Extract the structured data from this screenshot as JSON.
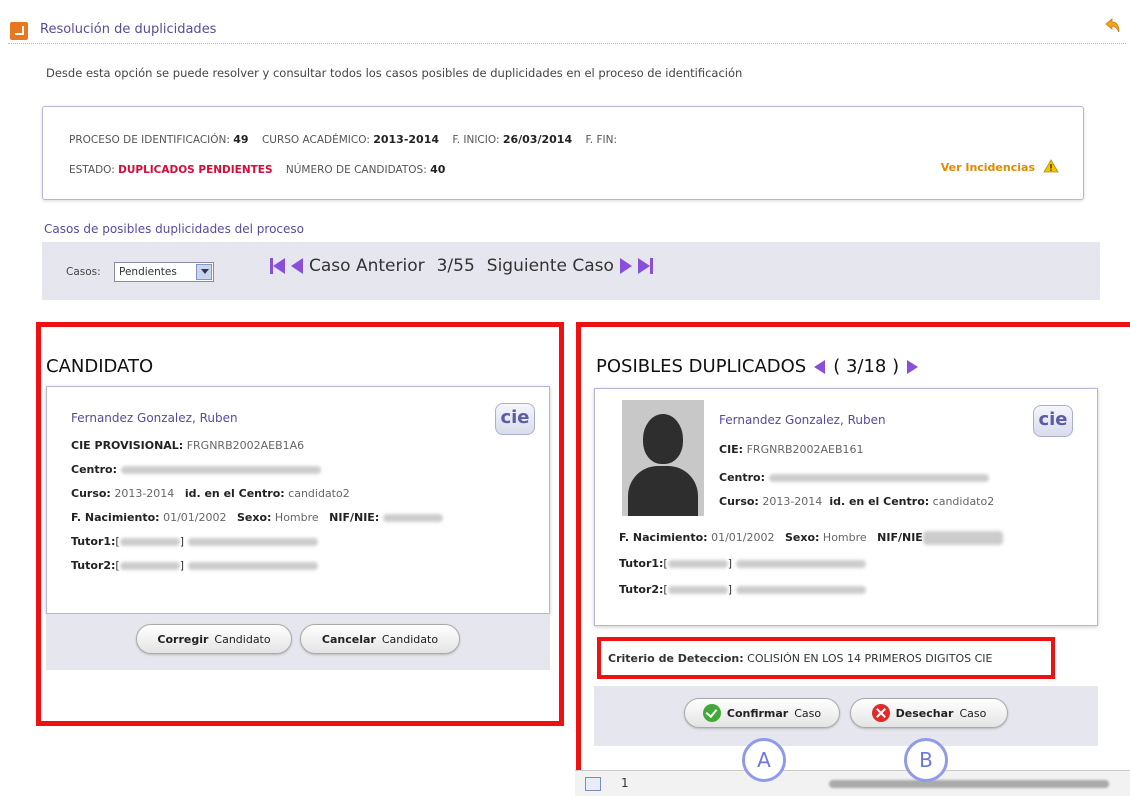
{
  "header": {
    "title": "Resolución de duplicidades",
    "description": "Desde esta opción se puede resolver y consultar todos los casos posibles de duplicidades en el proceso de identificación"
  },
  "info": {
    "proceso_label": "PROCESO DE IDENTIFICACIÓN:",
    "proceso_value": "49",
    "curso_label": "CURSO ACADÉMICO:",
    "curso_value": "2013-2014",
    "inicio_label": "F. INICIO:",
    "inicio_value": "26/03/2014",
    "fin_label": "F. FIN:",
    "estado_label": "ESTADO:",
    "estado_value": "DUPLICADOS PENDIENTES",
    "candidatos_label": "NÚMERO DE CANDIDATOS:",
    "candidatos_value": "40",
    "incidencias_link": "Ver Incidencias"
  },
  "section_title": "Casos de posibles duplicidades del proceso",
  "nav": {
    "casos_label": "Casos:",
    "casos_selected": "Pendientes",
    "prev_label": "Caso Anterior",
    "counter": "3/55",
    "next_label": "Siguiente Caso"
  },
  "candidato": {
    "panel_title": "CANDIDATO",
    "name": "Fernandez Gonzalez, Ruben",
    "cie_label": "CIE PROVISIONAL:",
    "cie_value": "FRGNRB2002AEB1A6",
    "centro_label": "Centro:",
    "curso_label": "Curso:",
    "curso_value": "2013-2014",
    "idcentro_label": "id. en el Centro:",
    "idcentro_value": "candidato2",
    "nac_label": "F. Nacimiento:",
    "nac_value": "01/01/2002",
    "sexo_label": "Sexo:",
    "sexo_value": "Hombre",
    "nif_label": "NIF/NIE:",
    "tutor1_label": "Tutor1:",
    "tutor2_label": "Tutor2:",
    "cie_logo": "cie",
    "btn_corregir_b": "Corregir",
    "btn_corregir": "Candidato",
    "btn_cancelar_b": "Cancelar",
    "btn_cancelar": "Candidato"
  },
  "duplicados": {
    "panel_title": "POSIBLES DUPLICADOS",
    "counter": "( 3/18 )",
    "name": "Fernandez Gonzalez, Ruben",
    "cie_label": "CIE:",
    "cie_value": "FRGNRB2002AEB161",
    "centro_label": "Centro:",
    "curso_label": "Curso:",
    "curso_value": "2013-2014",
    "idcentro_label": "id. en el Centro:",
    "idcentro_value": "candidato2",
    "nac_label": "F. Nacimiento:",
    "nac_value": "01/01/2002",
    "sexo_label": "Sexo:",
    "sexo_value": "Hombre",
    "nif_label": "NIF/NIE",
    "tutor1_label": "Tutor1:",
    "tutor2_label": "Tutor2:",
    "cie_logo": "cie",
    "criterio_label": "Criterio de Deteccion:",
    "criterio_value": "COLISIÓN EN LOS 14 PRIMEROS DIGITOS CIE",
    "btn_confirmar_b": "Confirmar",
    "btn_confirmar": "Caso",
    "btn_desechar_b": "Desechar",
    "btn_desechar": "Caso"
  },
  "badges": {
    "a": "A",
    "b": "B"
  },
  "strip": {
    "number": "1"
  },
  "colors": {
    "accent": "#5a4a9c",
    "highlight_red": "#ee1111",
    "nav_arrows": "#8a4fd8",
    "status_red": "#d60b3a"
  }
}
